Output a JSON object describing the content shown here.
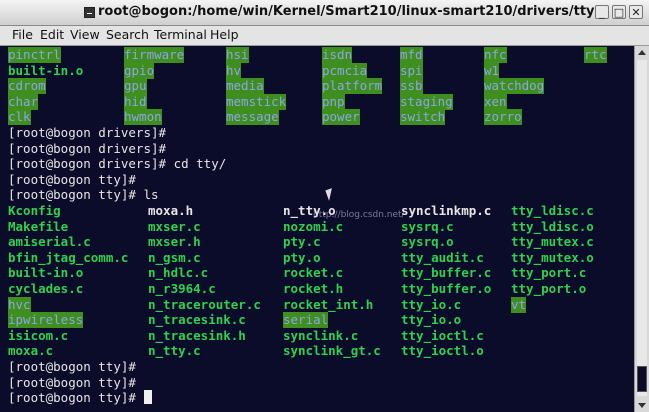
{
  "window": {
    "title": "root@bogon:/home/win/Kernel/Smart210/linux-smart210/drivers/tty",
    "controls": {
      "minimize": "_",
      "maximize": "□",
      "close": "✕"
    }
  },
  "menu": [
    "File",
    "Edit",
    "View",
    "Search",
    "Terminal",
    "Help"
  ],
  "terminal": {
    "watermark": "http://blog.csdn.net/",
    "lines": [
      {
        "cells": [
          {
            "text": "pinctrl",
            "type": "dir"
          },
          {
            "text": "firmware",
            "type": "dir"
          },
          {
            "text": "hsi",
            "type": "dir"
          },
          {
            "text": "isdn",
            "type": "dir"
          },
          {
            "text": "mfd",
            "type": "dir"
          },
          {
            "text": "nfc",
            "type": "dir"
          },
          {
            "text": "rtc",
            "type": "dir"
          }
        ]
      },
      {
        "cells": [
          {
            "text": "built-in.o",
            "type": "file"
          },
          {
            "text": "gpio",
            "type": "dir"
          },
          {
            "text": "hv",
            "type": "dir"
          },
          {
            "text": "pcmcia",
            "type": "dir"
          },
          {
            "text": "spi",
            "type": "dir"
          },
          {
            "text": "w1",
            "type": "dir"
          }
        ]
      },
      {
        "cells": [
          {
            "text": "cdrom",
            "type": "dir"
          },
          {
            "text": "gpu",
            "type": "dir"
          },
          {
            "text": "media",
            "type": "dir"
          },
          {
            "text": "platform",
            "type": "dir"
          },
          {
            "text": "ssb",
            "type": "dir"
          },
          {
            "text": "watchdog",
            "type": "dir"
          }
        ]
      },
      {
        "cells": [
          {
            "text": "char",
            "type": "dir"
          },
          {
            "text": "hid",
            "type": "dir"
          },
          {
            "text": "memstick",
            "type": "dir"
          },
          {
            "text": "pnp",
            "type": "dir"
          },
          {
            "text": "staging",
            "type": "dir"
          },
          {
            "text": "xen",
            "type": "dir"
          }
        ]
      },
      {
        "cells": [
          {
            "text": "clk",
            "type": "dir"
          },
          {
            "text": "hwmon",
            "type": "dir"
          },
          {
            "text": "message",
            "type": "dir"
          },
          {
            "text": "power",
            "type": "dir"
          },
          {
            "text": "switch",
            "type": "dir"
          },
          {
            "text": "zorro",
            "type": "dir"
          }
        ]
      },
      {
        "cells": [
          {
            "text": "[root@bogon drivers]#",
            "type": "prompt"
          }
        ]
      },
      {
        "cells": [
          {
            "text": "[root@bogon drivers]#",
            "type": "prompt"
          }
        ]
      },
      {
        "cells": [
          {
            "text": "[root@bogon drivers]# cd tty/",
            "type": "prompt"
          }
        ]
      },
      {
        "cells": [
          {
            "text": "[root@bogon tty]#",
            "type": "prompt"
          }
        ]
      },
      {
        "cells": [
          {
            "text": "[root@bogon tty]# ls",
            "type": "prompt"
          }
        ]
      },
      {
        "cells": [
          {
            "text": "Kconfig",
            "type": "file"
          },
          {
            "text": "moxa.h",
            "type": "src"
          },
          {
            "text": "n_tty.o",
            "type": "src"
          },
          {
            "text": "synclinkmp.c",
            "type": "src"
          },
          {
            "text": "tty_ldisc.c",
            "type": "file"
          }
        ]
      },
      {
        "cells": [
          {
            "text": "Makefile",
            "type": "file"
          },
          {
            "text": "mxser.c",
            "type": "file"
          },
          {
            "text": "nozomi.c",
            "type": "file"
          },
          {
            "text": "sysrq.c",
            "type": "file"
          },
          {
            "text": "tty_ldisc.o",
            "type": "file"
          }
        ]
      },
      {
        "cells": [
          {
            "text": "amiserial.c",
            "type": "file"
          },
          {
            "text": "mxser.h",
            "type": "file"
          },
          {
            "text": "pty.c",
            "type": "file"
          },
          {
            "text": "sysrq.o",
            "type": "file"
          },
          {
            "text": "tty_mutex.c",
            "type": "file"
          }
        ]
      },
      {
        "cells": [
          {
            "text": "bfin_jtag_comm.c",
            "type": "file"
          },
          {
            "text": "n_gsm.c",
            "type": "file"
          },
          {
            "text": "pty.o",
            "type": "file"
          },
          {
            "text": "tty_audit.c",
            "type": "file"
          },
          {
            "text": "tty_mutex.o",
            "type": "file"
          }
        ]
      },
      {
        "cells": [
          {
            "text": "built-in.o",
            "type": "file"
          },
          {
            "text": "n_hdlc.c",
            "type": "file"
          },
          {
            "text": "rocket.c",
            "type": "file"
          },
          {
            "text": "tty_buffer.c",
            "type": "file"
          },
          {
            "text": "tty_port.c",
            "type": "file"
          }
        ]
      },
      {
        "cells": [
          {
            "text": "cyclades.c",
            "type": "file"
          },
          {
            "text": "n_r3964.c",
            "type": "file"
          },
          {
            "text": "rocket.h",
            "type": "file"
          },
          {
            "text": "tty_buffer.o",
            "type": "file"
          },
          {
            "text": "tty_port.o",
            "type": "file"
          }
        ]
      },
      {
        "cells": [
          {
            "text": "hvc",
            "type": "dir"
          },
          {
            "text": "n_tracerouter.c",
            "type": "file"
          },
          {
            "text": "rocket_int.h",
            "type": "file"
          },
          {
            "text": "tty_io.c",
            "type": "file"
          },
          {
            "text": "vt",
            "type": "dir"
          }
        ]
      },
      {
        "cells": [
          {
            "text": "ipwireless",
            "type": "dir"
          },
          {
            "text": "n_tracesink.c",
            "type": "file"
          },
          {
            "text": "serial",
            "type": "dir"
          },
          {
            "text": "tty_io.o",
            "type": "file"
          }
        ]
      },
      {
        "cells": [
          {
            "text": "isicom.c",
            "type": "file"
          },
          {
            "text": "n_tracesink.h",
            "type": "file"
          },
          {
            "text": "synclink.c",
            "type": "file"
          },
          {
            "text": "tty_ioctl.c",
            "type": "file"
          }
        ]
      },
      {
        "cells": [
          {
            "text": "moxa.c",
            "type": "file"
          },
          {
            "text": "n_tty.c",
            "type": "file"
          },
          {
            "text": "synclink_gt.c",
            "type": "file"
          },
          {
            "text": "tty_ioctl.o",
            "type": "file"
          }
        ]
      },
      {
        "cells": [
          {
            "text": "[root@bogon tty]#",
            "type": "prompt"
          }
        ]
      },
      {
        "cells": [
          {
            "text": "[root@bogon tty]#",
            "type": "prompt"
          }
        ]
      },
      {
        "cells": [
          {
            "text": "[root@bogon tty]# ",
            "type": "prompt",
            "cursor": true
          }
        ]
      }
    ]
  }
}
